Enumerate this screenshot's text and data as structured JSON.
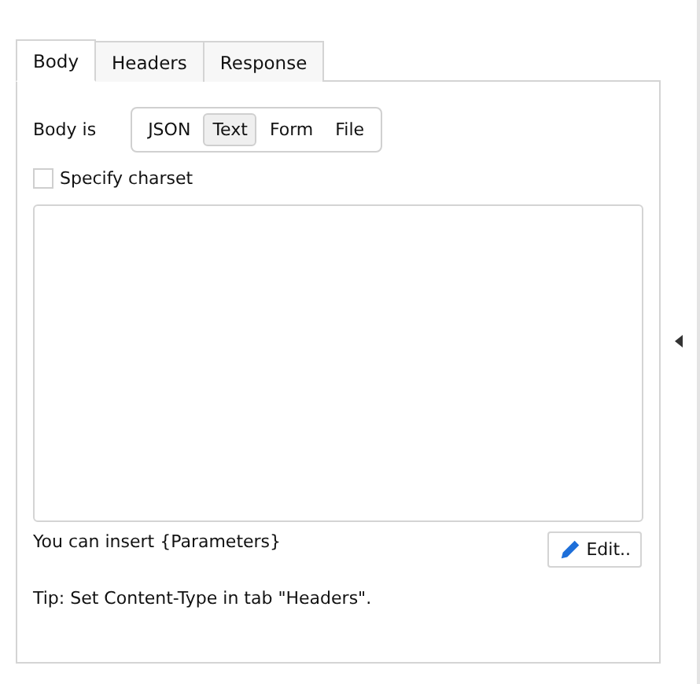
{
  "tabs": [
    {
      "label": "Body",
      "selected": true
    },
    {
      "label": "Headers",
      "selected": false
    },
    {
      "label": "Response",
      "selected": false
    }
  ],
  "body_type": {
    "label": "Body is",
    "options": [
      {
        "label": "JSON",
        "selected": false
      },
      {
        "label": "Text",
        "selected": true
      },
      {
        "label": "Form",
        "selected": false
      },
      {
        "label": "File",
        "selected": false
      }
    ]
  },
  "charset": {
    "label": "Specify charset",
    "checked": false
  },
  "hint": "You can insert {Parameters}",
  "edit_button": "Edit..",
  "tip": "Tip: Set Content-Type in tab \"Headers\"."
}
